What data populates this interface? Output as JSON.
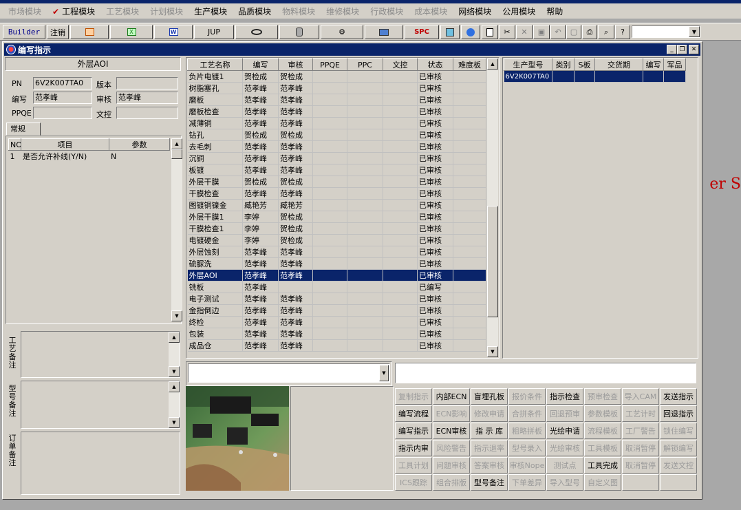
{
  "menu": {
    "items": [
      {
        "label": "市场模块",
        "state": "disabled"
      },
      {
        "label": "工程模块",
        "state": "checked"
      },
      {
        "label": "工艺模块",
        "state": "disabled"
      },
      {
        "label": "计划模块",
        "state": "disabled"
      },
      {
        "label": "生产模块",
        "state": "enabled"
      },
      {
        "label": "品质模块",
        "state": "enabled"
      },
      {
        "label": "物料模块",
        "state": "disabled"
      },
      {
        "label": "维修模块",
        "state": "disabled"
      },
      {
        "label": "行政模块",
        "state": "disabled"
      },
      {
        "label": "成本模块",
        "state": "disabled"
      },
      {
        "label": "网络模块",
        "state": "enabled"
      },
      {
        "label": "公用模块",
        "state": "enabled"
      },
      {
        "label": "帮助",
        "state": "enabled"
      }
    ]
  },
  "toolbar": {
    "builder_label": "Builder",
    "logout_label": "注销",
    "jup_label": "JUP",
    "spc_label": "SPC",
    "combo_value": ""
  },
  "window": {
    "title": "编写指示"
  },
  "info": {
    "heading": "外层AOI",
    "pn_label": "PN",
    "pn_value": "6V2K007TA0",
    "version_label": "版本",
    "version_value": "",
    "author_label": "编写",
    "author_value": "范孝峰",
    "review_label": "审核",
    "review_value": "范孝峰",
    "ppqe_label": "PPQE",
    "ppqe_value": "",
    "wenkong_label": "文控",
    "wenkong_value": ""
  },
  "params": {
    "tab_label": "常规",
    "headers": [
      "NO",
      "项目",
      "参数"
    ],
    "rows": [
      {
        "no": "1",
        "item": "是否允许补线(Y/N)",
        "value": "N"
      }
    ]
  },
  "notes": {
    "process_label": "工艺备注",
    "model_label": "型号备注",
    "order_label": "订单备注"
  },
  "process_table": {
    "headers": [
      "工艺名称",
      "编写",
      "审核",
      "PPQE",
      "PPC",
      "文控",
      "状态",
      "难度板"
    ],
    "selected_index": 17,
    "rows": [
      [
        "负片电镀1",
        "贺检成",
        "贺检成",
        "",
        "",
        "",
        "已审核",
        ""
      ],
      [
        "树脂塞孔",
        "范孝峰",
        "范孝峰",
        "",
        "",
        "",
        "已审核",
        ""
      ],
      [
        "磨板",
        "范孝峰",
        "范孝峰",
        "",
        "",
        "",
        "已审核",
        ""
      ],
      [
        "磨板检查",
        "范孝峰",
        "范孝峰",
        "",
        "",
        "",
        "已审核",
        ""
      ],
      [
        "减薄铜",
        "范孝峰",
        "范孝峰",
        "",
        "",
        "",
        "已审核",
        ""
      ],
      [
        "钻孔",
        "贺检成",
        "贺检成",
        "",
        "",
        "",
        "已审核",
        ""
      ],
      [
        "去毛刺",
        "范孝峰",
        "范孝峰",
        "",
        "",
        "",
        "已审核",
        ""
      ],
      [
        "沉铜",
        "范孝峰",
        "范孝峰",
        "",
        "",
        "",
        "已审核",
        ""
      ],
      [
        "板镀",
        "范孝峰",
        "范孝峰",
        "",
        "",
        "",
        "已审核",
        ""
      ],
      [
        "外层干膜",
        "贺检成",
        "贺检成",
        "",
        "",
        "",
        "已审核",
        ""
      ],
      [
        "干膜检查",
        "范孝峰",
        "范孝峰",
        "",
        "",
        "",
        "已审核",
        ""
      ],
      [
        "图镀铜镍金",
        "臧艳芳",
        "臧艳芳",
        "",
        "",
        "",
        "已审核",
        ""
      ],
      [
        "外层干膜1",
        "李婷",
        "贺检成",
        "",
        "",
        "",
        "已审核",
        ""
      ],
      [
        "干膜检查1",
        "李婷",
        "贺检成",
        "",
        "",
        "",
        "已审核",
        ""
      ],
      [
        "电镀硬金",
        "李婷",
        "贺检成",
        "",
        "",
        "",
        "已审核",
        ""
      ],
      [
        "外层蚀刻",
        "范孝峰",
        "范孝峰",
        "",
        "",
        "",
        "已审核",
        ""
      ],
      [
        "硫脲洗",
        "范孝峰",
        "范孝峰",
        "",
        "",
        "",
        "已审核",
        ""
      ],
      [
        "外层AOI",
        "范孝峰",
        "范孝峰",
        "",
        "",
        "",
        "已审核",
        ""
      ],
      [
        "铣板",
        "范孝峰",
        "",
        "",
        "",
        "",
        "已编写",
        ""
      ],
      [
        "电子测试",
        "范孝峰",
        "范孝峰",
        "",
        "",
        "",
        "已审核",
        ""
      ],
      [
        "金指倒边",
        "范孝峰",
        "范孝峰",
        "",
        "",
        "",
        "已审核",
        ""
      ],
      [
        "终检",
        "范孝峰",
        "范孝峰",
        "",
        "",
        "",
        "已审核",
        ""
      ],
      [
        "包装",
        "范孝峰",
        "范孝峰",
        "",
        "",
        "",
        "已审核",
        ""
      ],
      [
        "成品仓",
        "范孝峰",
        "范孝峰",
        "",
        "",
        "",
        "已审核",
        ""
      ]
    ]
  },
  "model_table": {
    "headers": [
      "生产型号",
      "类别",
      "S板",
      "交货期",
      "编写",
      "军品"
    ],
    "rows": [
      [
        "6V2K007TA0",
        "",
        "",
        "",
        "",
        ""
      ]
    ]
  },
  "bottom": {
    "dropdown_value": "",
    "text_value": ""
  },
  "actions": [
    [
      "复制指示",
      "内部ECN",
      "盲埋孔板",
      "报价条件",
      "指示检查",
      "预审检查",
      "导入CAM",
      "发送指示"
    ],
    [
      "编写流程",
      "ECN影响",
      "修改申请",
      "合拼条件",
      "回退预审",
      "参数模板",
      "工艺计时",
      "回退指示"
    ],
    [
      "编写指示",
      "ECN审核",
      "指 示 库",
      "粗略拼板",
      "光绘申请",
      "流程模板",
      "工厂警告",
      "锁住编写"
    ],
    [
      "指示内审",
      "风险警告",
      "指示退率",
      "型号录入",
      "光绘审核",
      "工具模板",
      "取消暂停",
      "解锁编写"
    ],
    [
      "工具计划",
      "问题审核",
      "答案审核",
      "审核Nope",
      "测试点",
      "工具完成",
      "取消暂停",
      "发送文控"
    ],
    [
      "ICS跟踪",
      "组合排版",
      "型号备注",
      "下单差异",
      "导入型号",
      "自定义图",
      "",
      ""
    ]
  ],
  "actions_enabled": [
    [
      false,
      true,
      true,
      false,
      true,
      false,
      false,
      true
    ],
    [
      true,
      false,
      false,
      false,
      false,
      false,
      false,
      true
    ],
    [
      true,
      true,
      true,
      false,
      true,
      false,
      false,
      false
    ],
    [
      true,
      false,
      false,
      false,
      false,
      false,
      false,
      false
    ],
    [
      false,
      false,
      false,
      false,
      false,
      true,
      false,
      false
    ],
    [
      false,
      false,
      true,
      false,
      false,
      false,
      false,
      false
    ]
  ],
  "background_text": "er S"
}
